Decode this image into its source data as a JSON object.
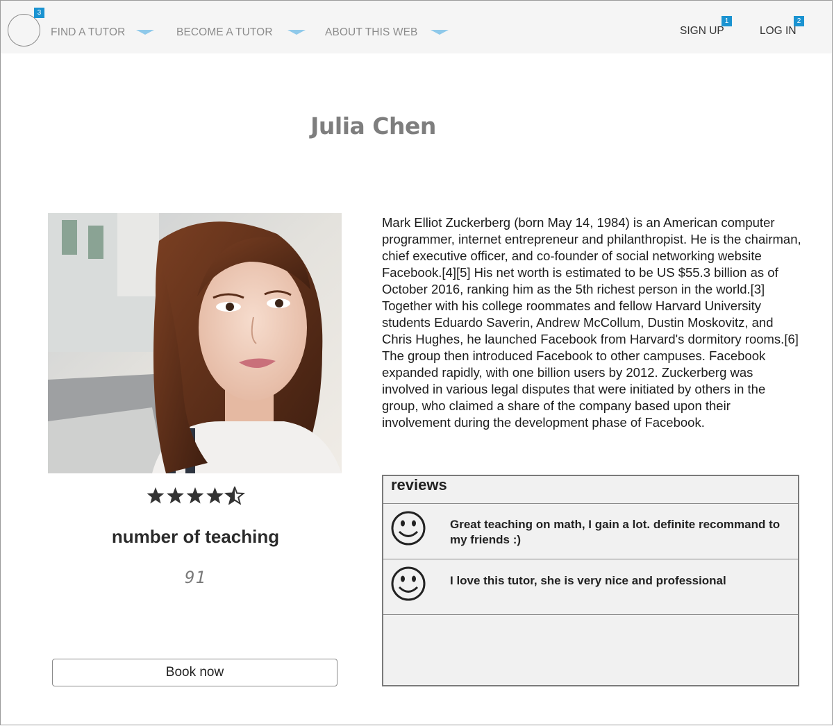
{
  "nav": {
    "logo_badge": "3",
    "items": [
      {
        "label": "FIND A TUTOR"
      },
      {
        "label": "BECOME A TUTOR"
      },
      {
        "label": "ABOUT THIS WEB"
      }
    ],
    "signup": {
      "label": "SIGN UP",
      "badge": "1"
    },
    "login": {
      "label": "LOG IN",
      "badge": "2"
    },
    "caret_color": "#8fc9ea",
    "badge_color": "#1b93d1"
  },
  "profile": {
    "name": "Julia Chen",
    "photo_icon": "tutor-photo",
    "rating": 4.5,
    "rating_max": 5,
    "teaching_label": "number of teaching",
    "teaching_count": "91",
    "book_label": "Book now"
  },
  "bio": {
    "paragraphs": [
      "Mark Elliot Zuckerberg (born May 14, 1984) is an American computer programmer, internet entrepreneur and philanthropist. He is the chairman, chief executive officer, and co-founder of social networking website Facebook.[4][5] His net worth is estimated to be US $55.3 billion as of October 2016, ranking him as the 5th richest person in the world.[3]",
      "Together with his college roommates and fellow Harvard University students Eduardo Saverin, Andrew McCollum, Dustin Moskovitz, and Chris Hughes, he launched Facebook from Harvard's dormitory rooms.[6] The group then introduced Facebook to other campuses. Facebook expanded rapidly, with one billion users by 2012. Zuckerberg was involved in various legal disputes that were initiated by others in the group, who claimed a share of the company based upon their involvement during the development phase of Facebook."
    ]
  },
  "reviews": {
    "heading": "reviews",
    "items": [
      {
        "icon": "smiley-icon",
        "text": "Great teaching on math, I gain a lot. definite recommand to my friends :)"
      },
      {
        "icon": "smiley-icon",
        "text": "I love this tutor, she is very nice and professional"
      }
    ]
  }
}
